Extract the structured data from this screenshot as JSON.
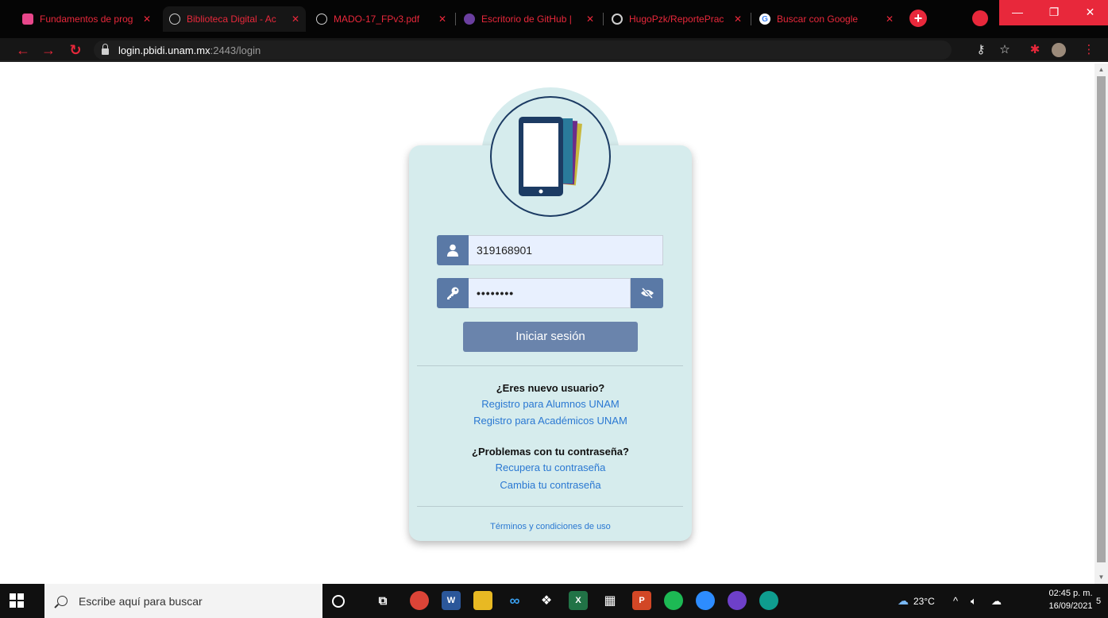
{
  "browser": {
    "tabs": [
      {
        "title": "Fundamentos de prog",
        "favicon": "classroom-icon",
        "active": false
      },
      {
        "title": "Biblioteca Digital - Ac",
        "favicon": "globe-icon",
        "active": true
      },
      {
        "title": "MADO-17_FPv3.pdf",
        "favicon": "globe-icon",
        "active": false
      },
      {
        "title": "Escritorio de GitHub |",
        "favicon": "github-desktop-icon",
        "active": false
      },
      {
        "title": "HugoPzk/ReportePrac",
        "favicon": "github-icon",
        "active": false
      },
      {
        "title": "Buscar con Google",
        "favicon": "google-icon",
        "active": false
      }
    ],
    "tab_close": "✕",
    "new_tab": "+",
    "url_host": "login.pbidi.unam.mx",
    "url_rest": ":2443/login",
    "window_controls": {
      "minimize": "—",
      "restore": "❐",
      "close": "✕"
    }
  },
  "login": {
    "username_value": "319168901",
    "password_value": "••••••••",
    "submit_label": "Iniciar sesión",
    "new_user_heading": "¿Eres nuevo usuario?",
    "register_students": "Registro para Alumnos UNAM",
    "register_academics": "Registro para Académicos UNAM",
    "password_problems_heading": "¿Problemas con tu contraseña?",
    "recover_password": "Recupera tu contraseña",
    "change_password": "Cambia tu contraseña",
    "terms": "Términos y condiciones de uso"
  },
  "taskbar": {
    "search_placeholder": "Escribe aquí para buscar",
    "temperature": "23°C",
    "time": "02:45 p. m.",
    "date": "16/09/2021",
    "notification_count": "5"
  },
  "colors": {
    "chrome_accent": "#e8283b",
    "card_bg": "#d6eced",
    "field_icon_bg": "#5a79a6",
    "button_bg": "#6a84ac",
    "link": "#2a78d2",
    "logo_navy": "#1c3b63"
  }
}
